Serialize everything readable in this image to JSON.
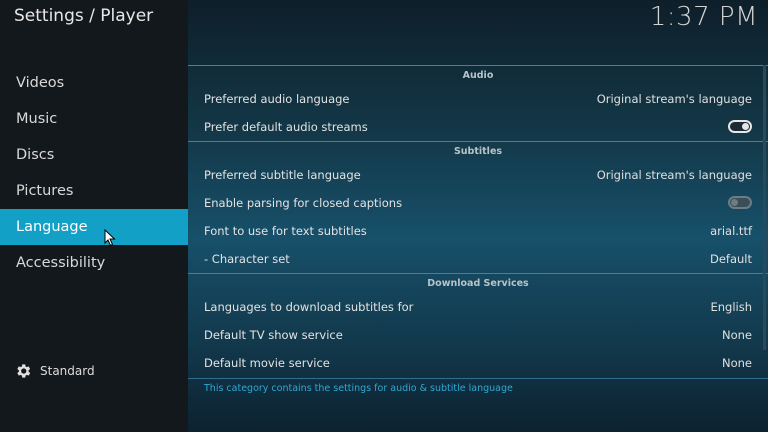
{
  "header": {
    "title": "Settings / Player",
    "clock": "1:37 PM"
  },
  "sidebar": {
    "items": [
      {
        "label": "Videos"
      },
      {
        "label": "Music"
      },
      {
        "label": "Discs"
      },
      {
        "label": "Pictures"
      },
      {
        "label": "Language",
        "active": true
      },
      {
        "label": "Accessibility"
      }
    ],
    "level": {
      "label": "Standard",
      "icon": "gear-icon"
    }
  },
  "groups": {
    "audio": {
      "title": "Audio",
      "rows": [
        {
          "label": "Preferred audio language",
          "value": "Original stream's language"
        },
        {
          "label": "Prefer default audio streams",
          "toggle": "on"
        }
      ]
    },
    "subtitles": {
      "title": "Subtitles",
      "rows": [
        {
          "label": "Preferred subtitle language",
          "value": "Original stream's language"
        },
        {
          "label": "Enable parsing for closed captions",
          "toggle": "off"
        },
        {
          "label": "Font to use for text subtitles",
          "value": "arial.ttf"
        },
        {
          "label": "- Character set",
          "value": "Default"
        }
      ]
    },
    "download": {
      "title": "Download Services",
      "rows": [
        {
          "label": "Languages to download subtitles for",
          "value": "English"
        },
        {
          "label": "Default TV show service",
          "value": "None"
        },
        {
          "label": "Default movie service",
          "value": "None"
        }
      ]
    }
  },
  "description": "This category contains the settings for audio & subtitle language",
  "colors": {
    "accent": "#12a0c7",
    "sidebar": "#13181c",
    "description": "#2fa8d4"
  }
}
